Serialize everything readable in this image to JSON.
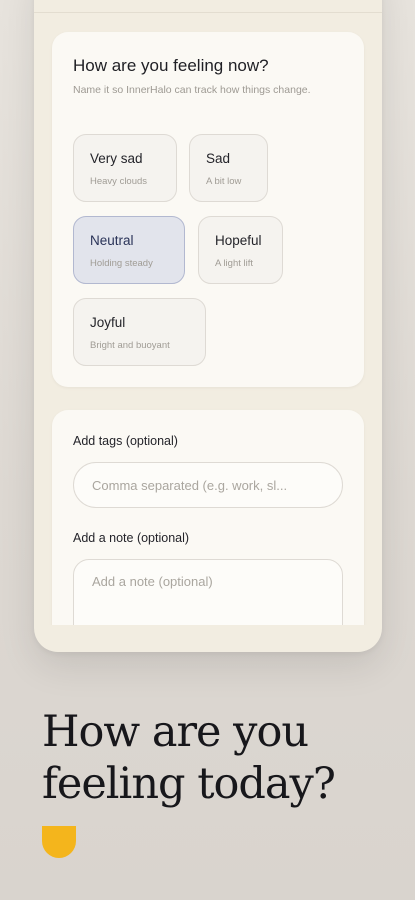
{
  "mood_card": {
    "title": "How are you feeling now?",
    "subtitle": "Name it so InnerHalo can track how things change.",
    "selected": "Neutral",
    "moods": [
      {
        "label": "Very sad",
        "description": "Heavy clouds"
      },
      {
        "label": "Sad",
        "description": "A bit low"
      },
      {
        "label": "Neutral",
        "description": "Holding steady"
      },
      {
        "label": "Hopeful",
        "description": "A light lift"
      },
      {
        "label": "Joyful",
        "description": "Bright and buoyant"
      }
    ]
  },
  "details_card": {
    "tags_label": "Add tags (optional)",
    "tags_placeholder": "Comma separated (e.g. work, sl...",
    "tags_value": "",
    "note_label": "Add a note (optional)",
    "note_placeholder": "Add a note (optional)",
    "note_value": ""
  },
  "marketing": {
    "headline_line1": "How are you",
    "headline_line2": "feeling today?"
  },
  "colors": {
    "background": "#e2ded8",
    "phone_surface": "#f2ede1",
    "card": "#fbf9f4",
    "selected_chip": "#e2e4ec",
    "selected_chip_border": "#b2b8d0",
    "brand_accent": "#f4b51c"
  }
}
